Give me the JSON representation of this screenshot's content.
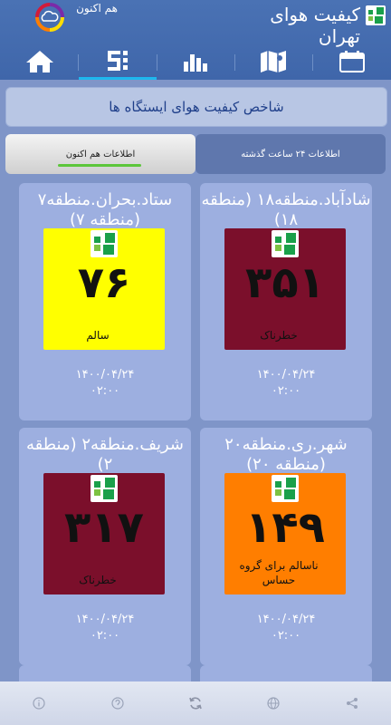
{
  "header": {
    "app_title": "کیفیت هوای تهران",
    "now_label": "هم اکنون"
  },
  "tabs": [
    {
      "name": "calendar",
      "icon": "calendar-icon"
    },
    {
      "name": "map",
      "icon": "map-icon"
    },
    {
      "name": "charts",
      "icon": "bar-chart-icon"
    },
    {
      "name": "stations",
      "icon": "stations-list-icon",
      "active": true
    },
    {
      "name": "home",
      "icon": "home-icon"
    }
  ],
  "section_title": "شاخص کیفیت هوای ایستگاه ها",
  "toggles": {
    "past_24h": "اطلاعات ۲۴ ساعت گذشته",
    "now": "اطلاعات هم اکنون"
  },
  "stations": [
    {
      "name": "شادآباد.منطقه۱۸ (منطقه ۱۸)",
      "aqi": "۳۵۱",
      "status": "خطرناک",
      "color": "#7b0f2b",
      "text_color": "#111111",
      "date": "۱۴۰۰/۰۴/۲۴",
      "time": "۰۲:۰۰"
    },
    {
      "name": "ستاد.بحران.منطقه۷ (منطقه ۷)",
      "aqi": "۷۶",
      "status": "سالم",
      "color": "#ffff00",
      "text_color": "#111111",
      "date": "۱۴۰۰/۰۴/۲۴",
      "time": "۰۲:۰۰"
    },
    {
      "name": "شهر.ری.منطقه۲۰ (منطقه ۲۰)",
      "aqi": "۱۴۹",
      "status": "ناسالم برای گروه حساس",
      "color": "#ff7e00",
      "text_color": "#111111",
      "date": "۱۴۰۰/۰۴/۲۴",
      "time": "۰۲:۰۰"
    },
    {
      "name": "شریف.منطقه۲ (منطقه ۲)",
      "aqi": "۳۱۷",
      "status": "خطرناک",
      "color": "#7b0f2b",
      "text_color": "#111111",
      "date": "۱۴۰۰/۰۴/۲۴",
      "time": "۰۲:۰۰"
    }
  ],
  "bottom_bar": [
    {
      "icon": "share-icon"
    },
    {
      "icon": "globe-icon"
    },
    {
      "icon": "refresh-icon"
    },
    {
      "icon": "help-icon"
    },
    {
      "icon": "info-icon"
    }
  ],
  "colors": {
    "header": "#4369ad",
    "accent": "#1eb8ee",
    "background": "#7f95c8",
    "card": "#9dafe0",
    "toggle_underline": "#5cc63b"
  }
}
